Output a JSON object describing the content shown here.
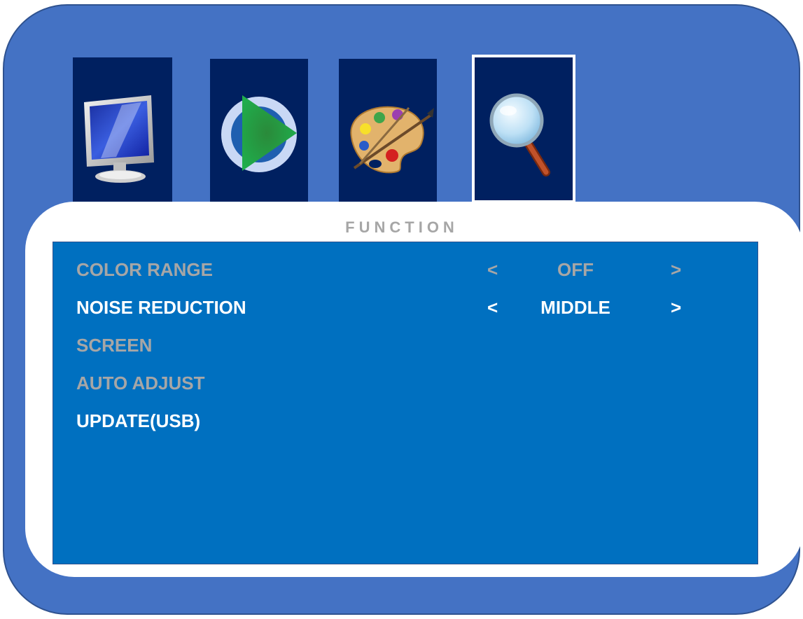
{
  "colors": {
    "frame": "#4472c4",
    "tab_bg": "#002060",
    "menu_bg": "#0070c0",
    "text_dim": "#a6a6a6",
    "text_active": "#ffffff"
  },
  "tabs": [
    {
      "icon": "monitor-icon",
      "selected": false
    },
    {
      "icon": "play-icon",
      "selected": false
    },
    {
      "icon": "palette-icon",
      "selected": false
    },
    {
      "icon": "magnifier-icon",
      "selected": true
    }
  ],
  "panel": {
    "title": "FUNCTION"
  },
  "menu": {
    "items": [
      {
        "label": "COLOR RANGE",
        "state": "dim",
        "arrow_left": "<",
        "value": "OFF",
        "arrow_right": ">"
      },
      {
        "label": "NOISE REDUCTION",
        "state": "active",
        "arrow_left": "<",
        "value": "MIDDLE",
        "arrow_right": ">"
      },
      {
        "label": "SCREEN",
        "state": "dim"
      },
      {
        "label": "AUTO ADJUST",
        "state": "dim"
      },
      {
        "label": "UPDATE(USB)",
        "state": "active"
      }
    ]
  }
}
